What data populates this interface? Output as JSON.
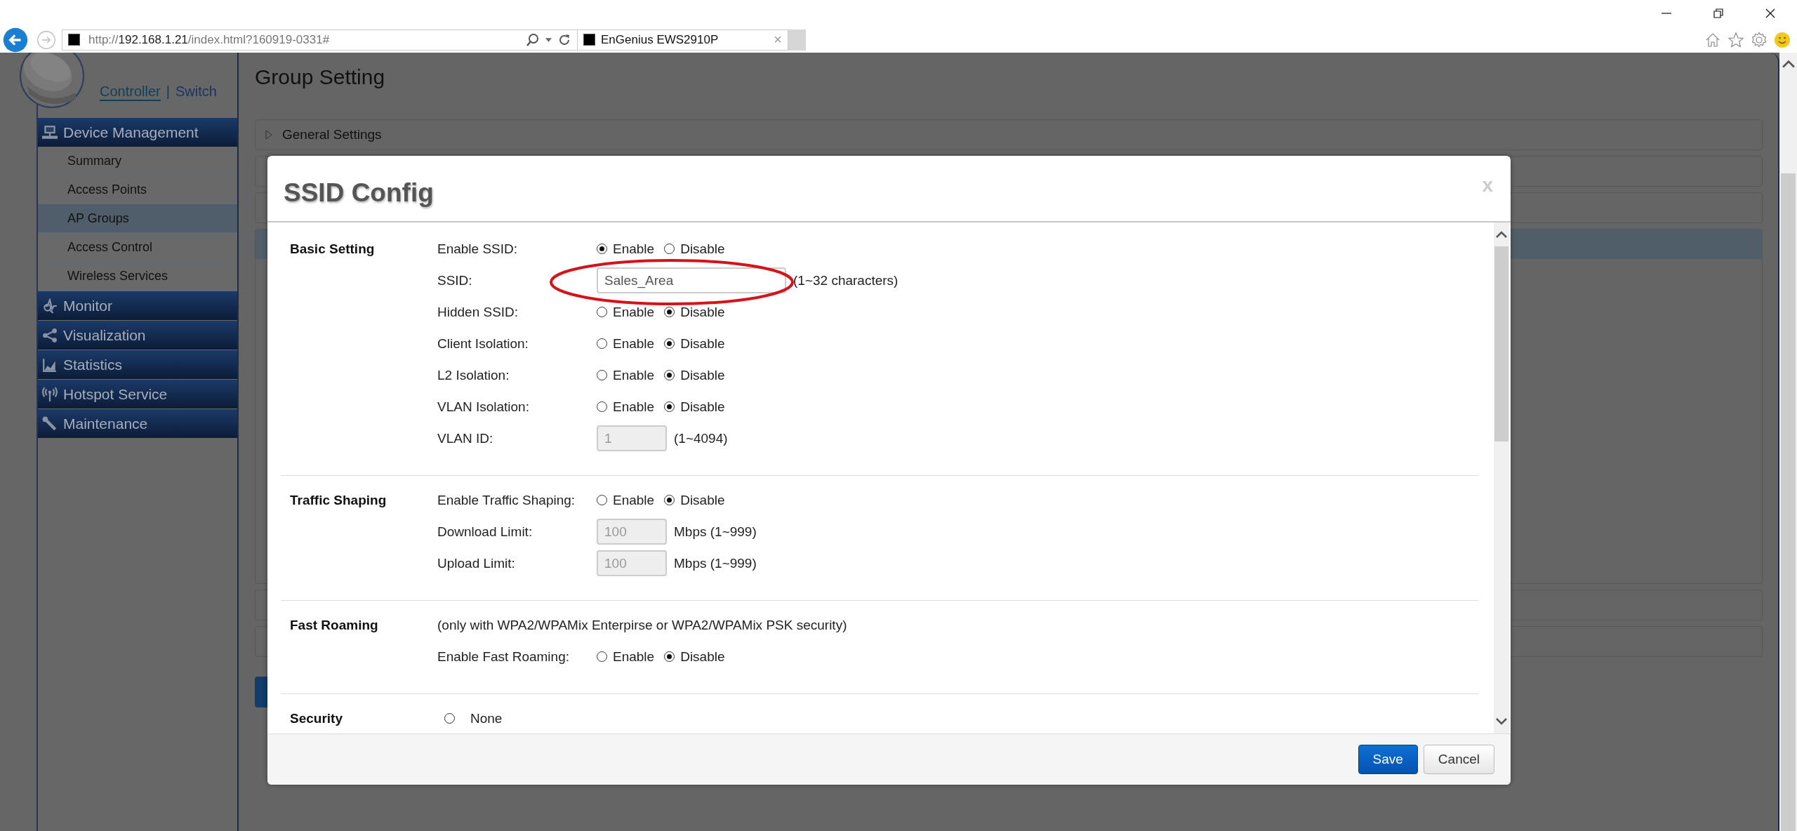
{
  "browser": {
    "address": {
      "scheme": "http://",
      "host": "192.168.1.21",
      "path": "/index.html?160919-0331#"
    },
    "tabs": [
      {
        "title": "EnGenius EWS2910P",
        "close": "×",
        "selected": true
      }
    ]
  },
  "sidebar": {
    "switcher": [
      {
        "label": "Controller",
        "selected": true
      },
      {
        "label": "Switch",
        "selected": false
      }
    ],
    "separator": "|",
    "menu": [
      {
        "label": "Device Management",
        "children": [
          {
            "label": "Summary",
            "selected": false
          },
          {
            "label": "Access Points",
            "selected": false
          },
          {
            "label": "AP Groups",
            "selected": true
          },
          {
            "label": "Access Control",
            "selected": false
          },
          {
            "label": "Wireless Services",
            "selected": false
          }
        ]
      },
      {
        "label": "Monitor"
      },
      {
        "label": "Visualization"
      },
      {
        "label": "Statistics"
      },
      {
        "label": "Hotspot Service"
      },
      {
        "label": "Maintenance"
      }
    ]
  },
  "page": {
    "title": "Group Setting",
    "panels": [
      {
        "label": "General Settings",
        "expanded": false
      },
      {
        "expanded": false
      },
      {
        "expanded": false
      },
      {
        "expanded": true
      },
      {
        "expanded": false
      },
      {
        "expanded": false
      }
    ]
  },
  "dialog": {
    "title": "SSID Config",
    "close": "x",
    "sections": [
      {
        "title": "Basic Setting",
        "rows": [
          {
            "kind": "radio",
            "label": "Enable SSID:",
            "options": [
              {
                "label": "Enable",
                "selected": true
              },
              {
                "label": "Disable",
                "selected": false
              }
            ]
          },
          {
            "kind": "text",
            "label": "SSID:",
            "value": "Sales_Area",
            "disabled": false,
            "hint": "(1~32 characters)"
          },
          {
            "kind": "radio",
            "label": "Hidden SSID:",
            "options": [
              {
                "label": "Enable",
                "selected": false
              },
              {
                "label": "Disable",
                "selected": true
              }
            ]
          },
          {
            "kind": "radio",
            "label": "Client Isolation:",
            "options": [
              {
                "label": "Enable",
                "selected": false
              },
              {
                "label": "Disable",
                "selected": true
              }
            ]
          },
          {
            "kind": "radio",
            "label": "L2 Isolation:",
            "options": [
              {
                "label": "Enable",
                "selected": false
              },
              {
                "label": "Disable",
                "selected": true
              }
            ]
          },
          {
            "kind": "radio",
            "label": "VLAN Isolation:",
            "options": [
              {
                "label": "Enable",
                "selected": false
              },
              {
                "label": "Disable",
                "selected": true
              }
            ]
          },
          {
            "kind": "number",
            "label": "VLAN ID:",
            "value": "1",
            "disabled": true,
            "hint": "(1~4094)"
          }
        ]
      },
      {
        "title": "Traffic Shaping",
        "rows": [
          {
            "kind": "radio",
            "label": "Enable Traffic Shaping:",
            "options": [
              {
                "label": "Enable",
                "selected": false
              },
              {
                "label": "Disable",
                "selected": true
              }
            ]
          },
          {
            "kind": "number",
            "label": "Download Limit:",
            "value": "100",
            "disabled": true,
            "hint": "Mbps (1~999)"
          },
          {
            "kind": "number",
            "label": "Upload Limit:",
            "value": "100",
            "disabled": true,
            "hint": "Mbps (1~999)"
          }
        ]
      },
      {
        "title": "Fast Roaming",
        "rows": [
          {
            "kind": "note",
            "text": "(only with WPA2/WPAMix Enterpirse or WPA2/WPAMix PSK security)"
          },
          {
            "kind": "radio",
            "label": "Enable Fast Roaming:",
            "options": [
              {
                "label": "Enable",
                "selected": false
              },
              {
                "label": "Disable",
                "selected": true
              }
            ]
          }
        ]
      },
      {
        "title": "Security",
        "rows": [
          {
            "kind": "radio",
            "options": [
              {
                "label": "None",
                "selected": false
              }
            ]
          }
        ]
      }
    ],
    "buttons": [
      {
        "label": "Save",
        "kind": "primary"
      },
      {
        "label": "Cancel",
        "kind": "secondary"
      }
    ]
  }
}
